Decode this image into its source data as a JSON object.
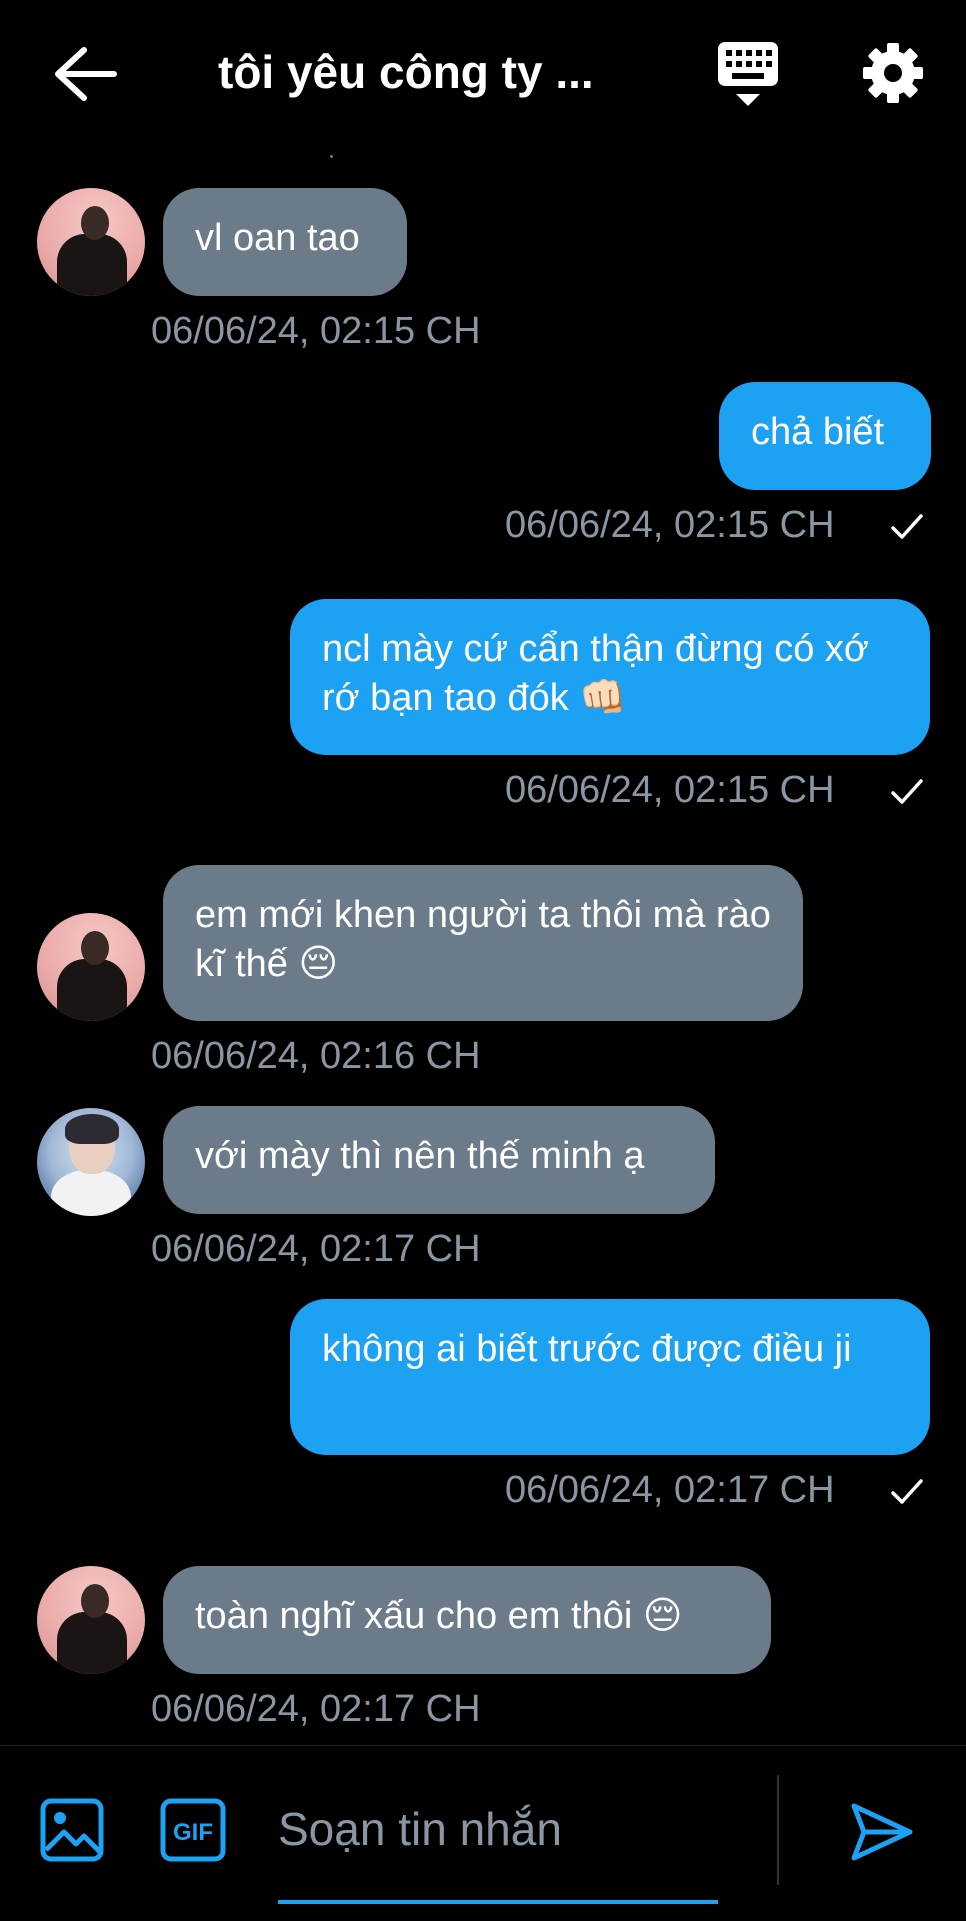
{
  "header": {
    "title": "tôi yêu công ty ...",
    "back_icon": "arrow-left-icon",
    "keyboard_icon": "keyboard-icon",
    "settings_icon": "gear-icon"
  },
  "messages": [
    {
      "side": "in",
      "text": "vl oan tao",
      "time": "06/06/24, 02:15 CH",
      "avatar": "avatar-pink"
    },
    {
      "side": "out",
      "text": "chả biết",
      "time": "06/06/24, 02:15 CH"
    },
    {
      "side": "out",
      "text": "ncl mày cứ cẩn thận đừng có xớ rớ bạn tao đók 👊🏻",
      "time": "06/06/24, 02:15 CH"
    },
    {
      "side": "in",
      "text": "em mới khen người ta thôi mà rào kĩ thế 😔",
      "time": "06/06/24, 02:16 CH",
      "avatar": "avatar-pink"
    },
    {
      "side": "in",
      "text": "với mày thì nên thế minh ạ",
      "time": "06/06/24, 02:17 CH",
      "avatar": "avatar-blue"
    },
    {
      "side": "out",
      "text": "không ai biết trước được điều ji",
      "time": "06/06/24, 02:17 CH"
    },
    {
      "side": "in",
      "text": "toàn nghĩ xấu cho em thôi 😔",
      "time": "06/06/24, 02:17 CH",
      "avatar": "avatar-pink"
    }
  ],
  "composer": {
    "placeholder": "Soạn tin nhắn",
    "gif_label": "GIF",
    "image_icon": "image-icon",
    "send_icon": "send-icon"
  },
  "colors": {
    "background": "#000000",
    "incoming_bubble": "#6b7b8a",
    "outgoing_bubble": "#1da1f2",
    "timestamp": "#8a96a3"
  }
}
